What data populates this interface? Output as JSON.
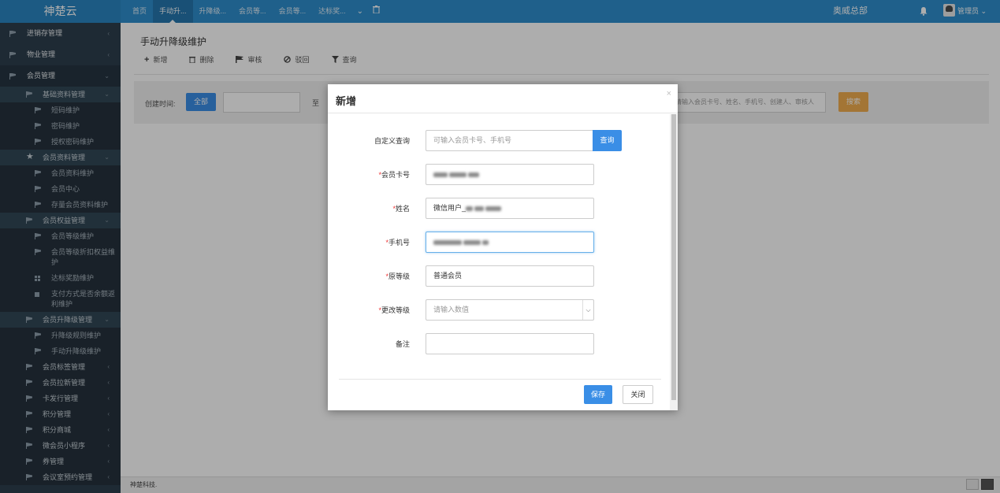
{
  "app": {
    "brand": "神楚云",
    "org": "奥威总部",
    "user": "管理员"
  },
  "topnav": {
    "tabs": [
      {
        "label": "首页"
      },
      {
        "label": "手动升...",
        "active": true
      },
      {
        "label": "升降级..."
      },
      {
        "label": "会员等..."
      },
      {
        "label": "会员等..."
      },
      {
        "label": "达标奖..."
      }
    ]
  },
  "sidebar": {
    "top": [
      {
        "label": "进销存管理"
      },
      {
        "label": "物业管理"
      },
      {
        "label": "会员管理"
      }
    ],
    "basic": {
      "label": "基础资料管理",
      "children": [
        "短码维护",
        "密码维护",
        "授权密码维护"
      ]
    },
    "member": {
      "label": "会员资料管理",
      "children": [
        "会员资料维护",
        "会员中心",
        "存量会员资料维护"
      ]
    },
    "rights": {
      "label": "会员权益管理",
      "children": [
        "会员等级维护",
        "会员等级折扣权益维护",
        "达标奖励维护",
        "支付方式是否余额返利维护"
      ]
    },
    "upgrade": {
      "label": "会员升降级管理",
      "children": [
        "升降级规则维护",
        "手动升降级维护"
      ]
    },
    "rest": [
      "会员标签管理",
      "会员拉新管理",
      "卡发行管理",
      "积分管理",
      "积分商城",
      "微会员小程序",
      "券管理",
      "会议室预约管理"
    ]
  },
  "page": {
    "title": "手动升降级维护",
    "toolbar": {
      "add": "新增",
      "delete": "删除",
      "audit": "审核",
      "reject": "驳回",
      "query": "查询"
    },
    "filter": {
      "created_label": "创建时间:",
      "all_btn": "全部",
      "to": "至",
      "search_placeholder": "请输入会员卡号、姓名、手机号、创建人、审核人",
      "search_btn": "搜索"
    },
    "footer": "神楚科技."
  },
  "modal": {
    "title": "新增",
    "close": "×",
    "fields": {
      "custom_query": {
        "label": "自定义查询",
        "placeholder": "可输入会员卡号、手机号",
        "button": "查询"
      },
      "card_no": {
        "label": "会员卡号"
      },
      "name": {
        "label": "姓名",
        "value": "微信用户_"
      },
      "phone": {
        "label": "手机号"
      },
      "orig_level": {
        "label": "原等级",
        "value": "普通会员"
      },
      "new_level": {
        "label": "更改等级",
        "placeholder": "请输入数值"
      },
      "remark": {
        "label": "备注",
        "value": ""
      }
    },
    "save": "保存",
    "cancel": "关闭"
  }
}
